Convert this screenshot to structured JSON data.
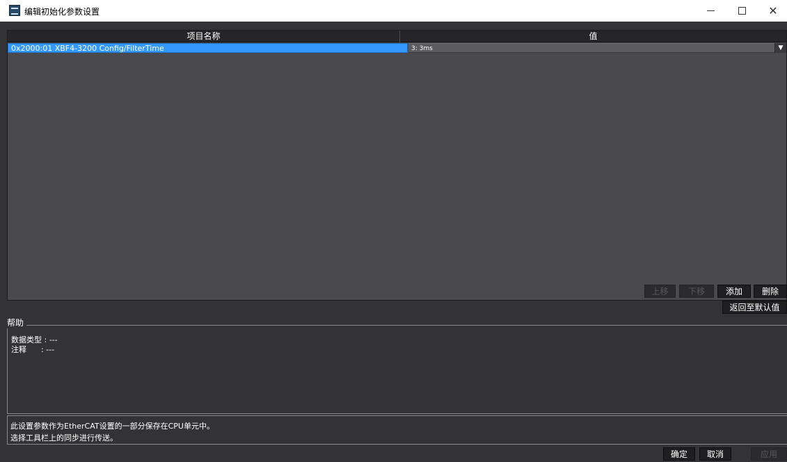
{
  "window": {
    "title": "编辑初始化参数设置",
    "minimize_glyph": "",
    "maximize_glyph": "",
    "close_glyph": "✕"
  },
  "grid": {
    "columns": [
      "项目名称",
      "值"
    ],
    "rows": [
      {
        "name": "0x2000:01 XBF4-3200 Config/FilterTime",
        "value": "3: 3ms",
        "selected": true
      }
    ],
    "dropdown_glyph": "▼"
  },
  "buttons": {
    "move_up": "上移",
    "move_down": "下移",
    "add": "添加",
    "delete": "删除",
    "reset_default": "返回至默认值",
    "ok": "确定",
    "cancel": "取消",
    "apply": "应用"
  },
  "help": {
    "title": "帮助",
    "data_type": "数据类型 : ---",
    "comment": "注释      : ---"
  },
  "info": {
    "line1": "此设置参数作为EtherCAT设置的一部分保存在CPU单元中。",
    "line2": "选择工具栏上的同步进行传送。"
  },
  "colors": {
    "background": "#333336",
    "grid_background": "#4a4a4d",
    "selection": "#3399ff"
  }
}
